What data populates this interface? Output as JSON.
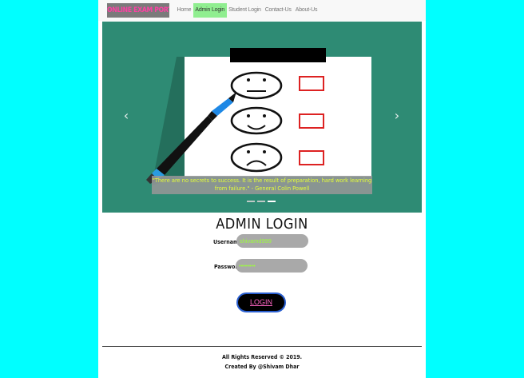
{
  "navbar": {
    "brand": "ONLINE EXAM PORTAL",
    "items": [
      {
        "label": "Home",
        "active": false
      },
      {
        "label": "Admin Login",
        "active": true
      },
      {
        "label": "Student Login",
        "active": false
      },
      {
        "label": "Contact-Us",
        "active": false
      },
      {
        "label": "About-Us",
        "active": false
      }
    ]
  },
  "carousel": {
    "prev_icon": "‹",
    "next_icon": "›",
    "caption": "\"There are no secrets to success. It is the result of preparation, hard work learning from failure.\" - General Colin Powell",
    "slide_count": 3,
    "active_slide": 3,
    "background_color": "#2e8b74"
  },
  "login": {
    "title": "ADMIN LOGIN",
    "username_label": "Username:",
    "username_value": "shivamd999",
    "password_label": "Password:",
    "password_value": "••••••••",
    "submit_label": "LOGIN"
  },
  "footer": {
    "line1": "All Rights Reserved © 2019.",
    "line2": "Created By @Shivam Dhar"
  },
  "colors": {
    "page_background": "#00ffff",
    "brand_text": "#ff3fa4",
    "active_nav": "#90ee90",
    "caption_text": "#e6ff37",
    "input_text": "#9cff3a",
    "login_text": "#ff66c4"
  }
}
